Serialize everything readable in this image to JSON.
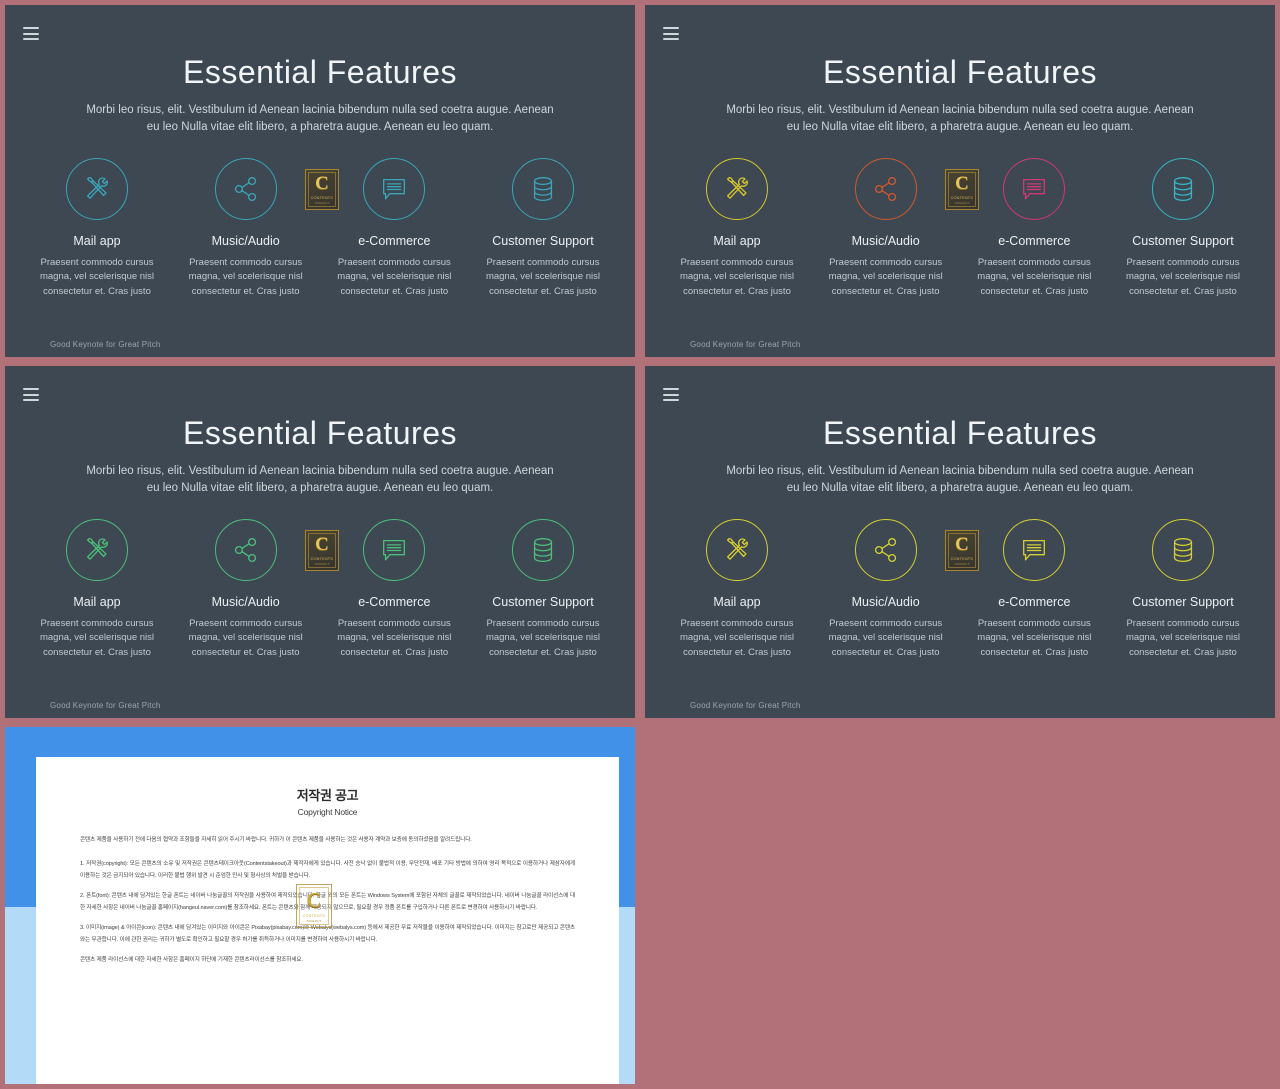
{
  "canvas": {
    "background_color": "#b27078",
    "slide_background_color": "#3d4852"
  },
  "slide": {
    "menu_icon": "hamburger-icon",
    "title": "Essential Features",
    "subtitle": "Morbi leo risus, elit. Vestibulum id Aenean lacinia bibendum nulla sed coetra augue. Aenean eu leo  Nulla vitae elit libero, a pharetra augue. Aenean eu leo quam.",
    "footer": "Good Keynote for Great Pitch",
    "features": [
      {
        "icon": "tools-icon",
        "title": "Mail app",
        "desc": "Praesent commodo cursus magna, vel scelerisque nisl consectetur et. Cras justo"
      },
      {
        "icon": "share-icon",
        "title": "Music/Audio",
        "desc": "Praesent commodo cursus magna, vel scelerisque nisl consectetur et. Cras justo"
      },
      {
        "icon": "chat-bubble-icon",
        "title": "e-Commerce",
        "desc": "Praesent commodo cursus magna, vel scelerisque nisl consectetur et. Cras justo"
      },
      {
        "icon": "database-icon",
        "title": "Customer Support",
        "desc": "Praesent commodo cursus magna, vel scelerisque nisl consectetur et. Cras justo"
      }
    ]
  },
  "variants": [
    {
      "id": "variant-teal",
      "name": "Teal",
      "icon_colors": [
        "#3aa6b9",
        "#3aa6b9",
        "#3aa6b9",
        "#3aa6b9"
      ]
    },
    {
      "id": "variant-multicolor",
      "name": "Multicolor",
      "icon_colors": [
        "#d6c72e",
        "#cf5a2c",
        "#cf3a72",
        "#36b6c4"
      ]
    },
    {
      "id": "variant-green",
      "name": "Green",
      "icon_colors": [
        "#4cbf7a",
        "#4cbf7a",
        "#4cbf7a",
        "#4cbf7a"
      ]
    },
    {
      "id": "variant-yellow",
      "name": "Yellow",
      "icon_colors": [
        "#d6cf33",
        "#d6cf33",
        "#d6cf33",
        "#d6cf33"
      ]
    }
  ],
  "watermark": {
    "letter": "C",
    "line1": "CONTENTS",
    "line2": "TAKEOUT",
    "gold_color": "#e8c55c"
  },
  "document": {
    "frame_color_top": "#4291e8",
    "frame_color_bottom": "#b3dbf7",
    "title_ko": "저작권 공고",
    "title_en": "Copyright Notice",
    "paragraphs": [
      "콘텐츠 제품을 사용하기 전에 다음의 협약과 조항들을 자세히 읽어 주시기 바랍니다. 귀하가 이 콘텐츠 제품을 사용하는 것은 사용자 계약과 보증에 동의하셨음을 알려드립니다.",
      "1. 저작권(copyright): 모든 콘텐츠의 소유 및 저작권은 콘텐츠테이크아웃(Contentstakeout)과 제작자에게 있습니다. 사전 승낙 없이 불법적 이용, 무단전재, 배포 기타 방법에 의하여 영리 목적으로 이용하거나 제삼자에게 이용하는 것은 금지되어 있습니다. 이러한 불법 행위 발견 시 준엄한 민사 및 형사상의 처벌을 받습니다.",
      "2. 폰트(font): 콘텐츠 내에 담겨있는 한글 폰트는 네이버 나눔글꼴의 저작권을 사용하여 제작되었습니다. 한글 외의 모든 폰트는 Windows System에 포함된 자체의 글꼴로 제작되었습니다. 네이버 나눔글꼴 라이선스에 대한 자세한 사항은 네이버 나눔글꼴 홈페이지(hangeul.naver.com)를 참조하세요. 폰트는 콘텐츠와 함께 제공되지 않으므로, 필요할 경우 정품 폰트를 구입하거나 다른 폰트로 변경하여 사용하시기 바랍니다.",
      "3. 이미지(image) & 아이콘(icon): 콘텐츠 내에 담겨있는 이미지와 아이콘은 Pixabay(pixabay.com)와 Webalys(webalys.com) 등에서 제공한 무료 저작물을 이용하여 제작되었습니다. 이미지는 참고로만 제공되고 콘텐츠와는 무관합니다. 이에 관한 권리는 귀하가 별도로 확인하고 필요할 경우 허가를 취득하거나 이미지를 변경하여 사용하시기 바랍니다.",
      "콘텐츠 제품 라이선스에 대한 자세한 사항은 홈페이지 하단에 기재한 콘텐츠라이선스를 참조하세요."
    ]
  }
}
